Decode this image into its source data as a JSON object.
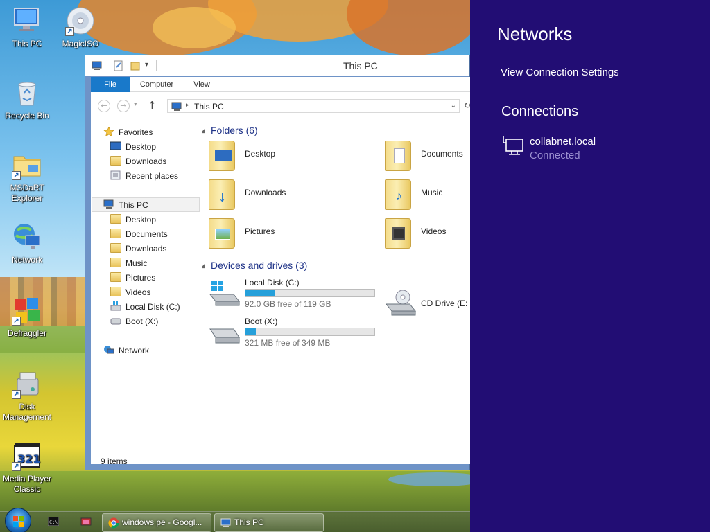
{
  "desktop": {
    "icons": [
      {
        "label": "This PC",
        "icon": "computer-icon"
      },
      {
        "label": "MagicISO",
        "icon": "cd-icon"
      },
      {
        "label": "Recycle Bin",
        "icon": "recycle-bin-icon"
      },
      {
        "label": "MSDaRT Explorer",
        "label_line1": "MSDaRT",
        "label_line2": "Explorer",
        "icon": "folder-shortcut-icon"
      },
      {
        "label": "Network",
        "icon": "network-globe-icon"
      },
      {
        "label": "Defraggler",
        "icon": "defraggler-icon"
      },
      {
        "label": "Disk Management",
        "label_line1": "Disk",
        "label_line2": "Management",
        "icon": "disk-management-icon"
      },
      {
        "label": "Media Player Classic",
        "label_line1": "Media Player",
        "label_line2": "Classic",
        "icon": "media-player-icon"
      }
    ]
  },
  "explorer": {
    "title": "This PC",
    "ribbon_tabs": [
      "File",
      "Computer",
      "View"
    ],
    "address": "This PC",
    "nav": {
      "favorites": "Favorites",
      "favorites_items": [
        "Desktop",
        "Downloads",
        "Recent places"
      ],
      "this_pc": "This PC",
      "this_pc_items": [
        "Desktop",
        "Documents",
        "Downloads",
        "Music",
        "Pictures",
        "Videos",
        "Local Disk (C:)",
        "Boot (X:)"
      ],
      "network": "Network"
    },
    "folders_header": "Folders (6)",
    "folders": [
      "Desktop",
      "Documents",
      "Downloads",
      "Music",
      "Pictures",
      "Videos"
    ],
    "devices_header": "Devices and drives (3)",
    "drives": [
      {
        "name": "Local Disk (C:)",
        "free": "92.0 GB free of 119 GB",
        "used_fraction": 0.23
      },
      {
        "name": "Boot (X:)",
        "free": "321 MB free of 349 MB",
        "used_fraction": 0.08
      },
      {
        "name": "CD Drive (E:",
        "free": "",
        "used_fraction": null
      }
    ],
    "status": "9 items"
  },
  "charm": {
    "title": "Networks",
    "view_settings": "View Connection Settings",
    "connections_header": "Connections",
    "connection_name": "collabnet.local",
    "connection_status": "Connected",
    "bg_color": "#220d74",
    "status_color": "#9b8fd0"
  },
  "taskbar": {
    "buttons": [
      {
        "label": "windows pe - Googl...",
        "icon": "chrome-icon"
      },
      {
        "label": "This PC",
        "icon": "computer-icon"
      }
    ]
  },
  "colors": {
    "accent": "#1979ca",
    "progress": "#26a0da",
    "group_header": "#1e3287"
  }
}
